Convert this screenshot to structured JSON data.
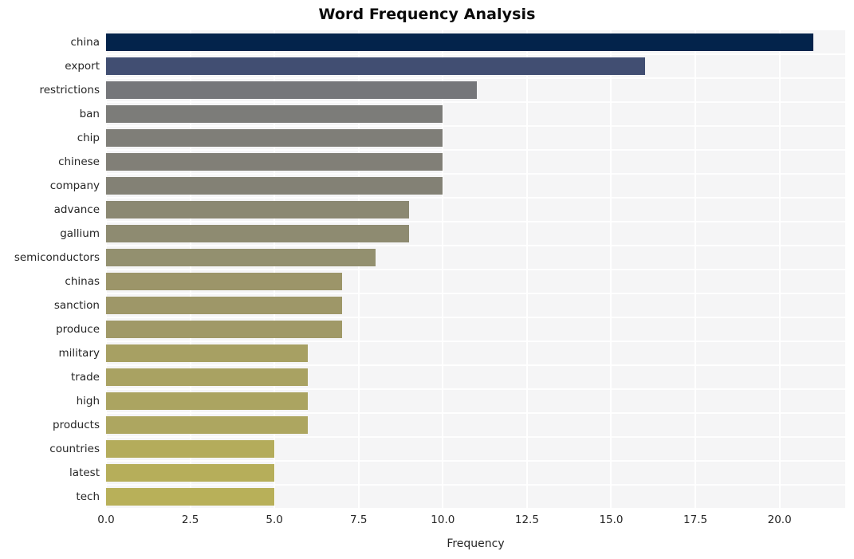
{
  "chart_data": {
    "type": "bar",
    "orientation": "horizontal",
    "title": "Word Frequency Analysis",
    "xlabel": "Frequency",
    "ylabel": "",
    "categories": [
      "china",
      "export",
      "restrictions",
      "ban",
      "chip",
      "chinese",
      "company",
      "advance",
      "gallium",
      "semiconductors",
      "chinas",
      "sanction",
      "produce",
      "military",
      "trade",
      "high",
      "products",
      "countries",
      "latest",
      "tech"
    ],
    "values": [
      21,
      16,
      11,
      10,
      10,
      10,
      10,
      9,
      9,
      8,
      7,
      7,
      7,
      6,
      6,
      6,
      6,
      5,
      5,
      5
    ],
    "bar_colors": [
      "#03234b",
      "#414e72",
      "#75767a",
      "#7c7c79",
      "#7f7e78",
      "#817f77",
      "#838175",
      "#8b8872",
      "#8e8b71",
      "#93906f",
      "#9c9569",
      "#9e9768",
      "#a09967",
      "#a7a063",
      "#a9a262",
      "#aba461",
      "#ada660",
      "#b4ac5b",
      "#b6ae5a",
      "#b8b059"
    ],
    "xticks": [
      "0.0",
      "2.5",
      "5.0",
      "7.5",
      "10.0",
      "12.5",
      "15.0",
      "17.5",
      "20.0"
    ],
    "xtick_values": [
      0,
      2.5,
      5,
      7.5,
      10,
      12.5,
      15,
      17.5,
      20
    ],
    "xlim": [
      0,
      21.95
    ],
    "grid": "vertical-white-on-gray",
    "legend": "none",
    "plot_background": "#f5f5f6",
    "figure_background": "#ffffff"
  }
}
